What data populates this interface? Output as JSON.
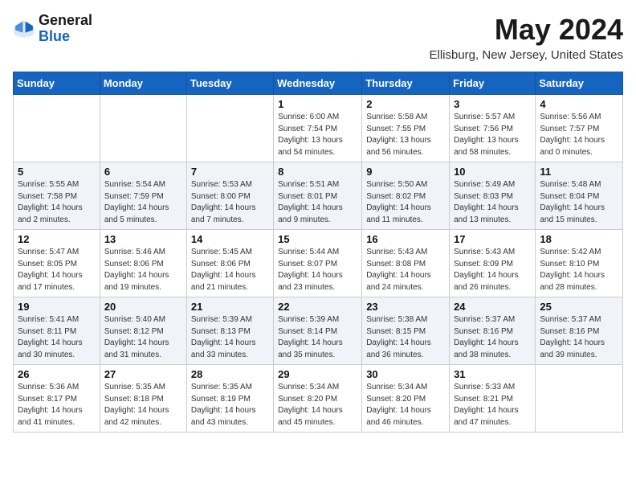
{
  "logo": {
    "general": "General",
    "blue": "Blue"
  },
  "title": "May 2024",
  "location": "Ellisburg, New Jersey, United States",
  "days_of_week": [
    "Sunday",
    "Monday",
    "Tuesday",
    "Wednesday",
    "Thursday",
    "Friday",
    "Saturday"
  ],
  "weeks": [
    [
      {
        "day": "",
        "info": ""
      },
      {
        "day": "",
        "info": ""
      },
      {
        "day": "",
        "info": ""
      },
      {
        "day": "1",
        "info": "Sunrise: 6:00 AM\nSunset: 7:54 PM\nDaylight: 13 hours\nand 54 minutes."
      },
      {
        "day": "2",
        "info": "Sunrise: 5:58 AM\nSunset: 7:55 PM\nDaylight: 13 hours\nand 56 minutes."
      },
      {
        "day": "3",
        "info": "Sunrise: 5:57 AM\nSunset: 7:56 PM\nDaylight: 13 hours\nand 58 minutes."
      },
      {
        "day": "4",
        "info": "Sunrise: 5:56 AM\nSunset: 7:57 PM\nDaylight: 14 hours\nand 0 minutes."
      }
    ],
    [
      {
        "day": "5",
        "info": "Sunrise: 5:55 AM\nSunset: 7:58 PM\nDaylight: 14 hours\nand 2 minutes."
      },
      {
        "day": "6",
        "info": "Sunrise: 5:54 AM\nSunset: 7:59 PM\nDaylight: 14 hours\nand 5 minutes."
      },
      {
        "day": "7",
        "info": "Sunrise: 5:53 AM\nSunset: 8:00 PM\nDaylight: 14 hours\nand 7 minutes."
      },
      {
        "day": "8",
        "info": "Sunrise: 5:51 AM\nSunset: 8:01 PM\nDaylight: 14 hours\nand 9 minutes."
      },
      {
        "day": "9",
        "info": "Sunrise: 5:50 AM\nSunset: 8:02 PM\nDaylight: 14 hours\nand 11 minutes."
      },
      {
        "day": "10",
        "info": "Sunrise: 5:49 AM\nSunset: 8:03 PM\nDaylight: 14 hours\nand 13 minutes."
      },
      {
        "day": "11",
        "info": "Sunrise: 5:48 AM\nSunset: 8:04 PM\nDaylight: 14 hours\nand 15 minutes."
      }
    ],
    [
      {
        "day": "12",
        "info": "Sunrise: 5:47 AM\nSunset: 8:05 PM\nDaylight: 14 hours\nand 17 minutes."
      },
      {
        "day": "13",
        "info": "Sunrise: 5:46 AM\nSunset: 8:06 PM\nDaylight: 14 hours\nand 19 minutes."
      },
      {
        "day": "14",
        "info": "Sunrise: 5:45 AM\nSunset: 8:06 PM\nDaylight: 14 hours\nand 21 minutes."
      },
      {
        "day": "15",
        "info": "Sunrise: 5:44 AM\nSunset: 8:07 PM\nDaylight: 14 hours\nand 23 minutes."
      },
      {
        "day": "16",
        "info": "Sunrise: 5:43 AM\nSunset: 8:08 PM\nDaylight: 14 hours\nand 24 minutes."
      },
      {
        "day": "17",
        "info": "Sunrise: 5:43 AM\nSunset: 8:09 PM\nDaylight: 14 hours\nand 26 minutes."
      },
      {
        "day": "18",
        "info": "Sunrise: 5:42 AM\nSunset: 8:10 PM\nDaylight: 14 hours\nand 28 minutes."
      }
    ],
    [
      {
        "day": "19",
        "info": "Sunrise: 5:41 AM\nSunset: 8:11 PM\nDaylight: 14 hours\nand 30 minutes."
      },
      {
        "day": "20",
        "info": "Sunrise: 5:40 AM\nSunset: 8:12 PM\nDaylight: 14 hours\nand 31 minutes."
      },
      {
        "day": "21",
        "info": "Sunrise: 5:39 AM\nSunset: 8:13 PM\nDaylight: 14 hours\nand 33 minutes."
      },
      {
        "day": "22",
        "info": "Sunrise: 5:39 AM\nSunset: 8:14 PM\nDaylight: 14 hours\nand 35 minutes."
      },
      {
        "day": "23",
        "info": "Sunrise: 5:38 AM\nSunset: 8:15 PM\nDaylight: 14 hours\nand 36 minutes."
      },
      {
        "day": "24",
        "info": "Sunrise: 5:37 AM\nSunset: 8:16 PM\nDaylight: 14 hours\nand 38 minutes."
      },
      {
        "day": "25",
        "info": "Sunrise: 5:37 AM\nSunset: 8:16 PM\nDaylight: 14 hours\nand 39 minutes."
      }
    ],
    [
      {
        "day": "26",
        "info": "Sunrise: 5:36 AM\nSunset: 8:17 PM\nDaylight: 14 hours\nand 41 minutes."
      },
      {
        "day": "27",
        "info": "Sunrise: 5:35 AM\nSunset: 8:18 PM\nDaylight: 14 hours\nand 42 minutes."
      },
      {
        "day": "28",
        "info": "Sunrise: 5:35 AM\nSunset: 8:19 PM\nDaylight: 14 hours\nand 43 minutes."
      },
      {
        "day": "29",
        "info": "Sunrise: 5:34 AM\nSunset: 8:20 PM\nDaylight: 14 hours\nand 45 minutes."
      },
      {
        "day": "30",
        "info": "Sunrise: 5:34 AM\nSunset: 8:20 PM\nDaylight: 14 hours\nand 46 minutes."
      },
      {
        "day": "31",
        "info": "Sunrise: 5:33 AM\nSunset: 8:21 PM\nDaylight: 14 hours\nand 47 minutes."
      },
      {
        "day": "",
        "info": ""
      }
    ]
  ]
}
